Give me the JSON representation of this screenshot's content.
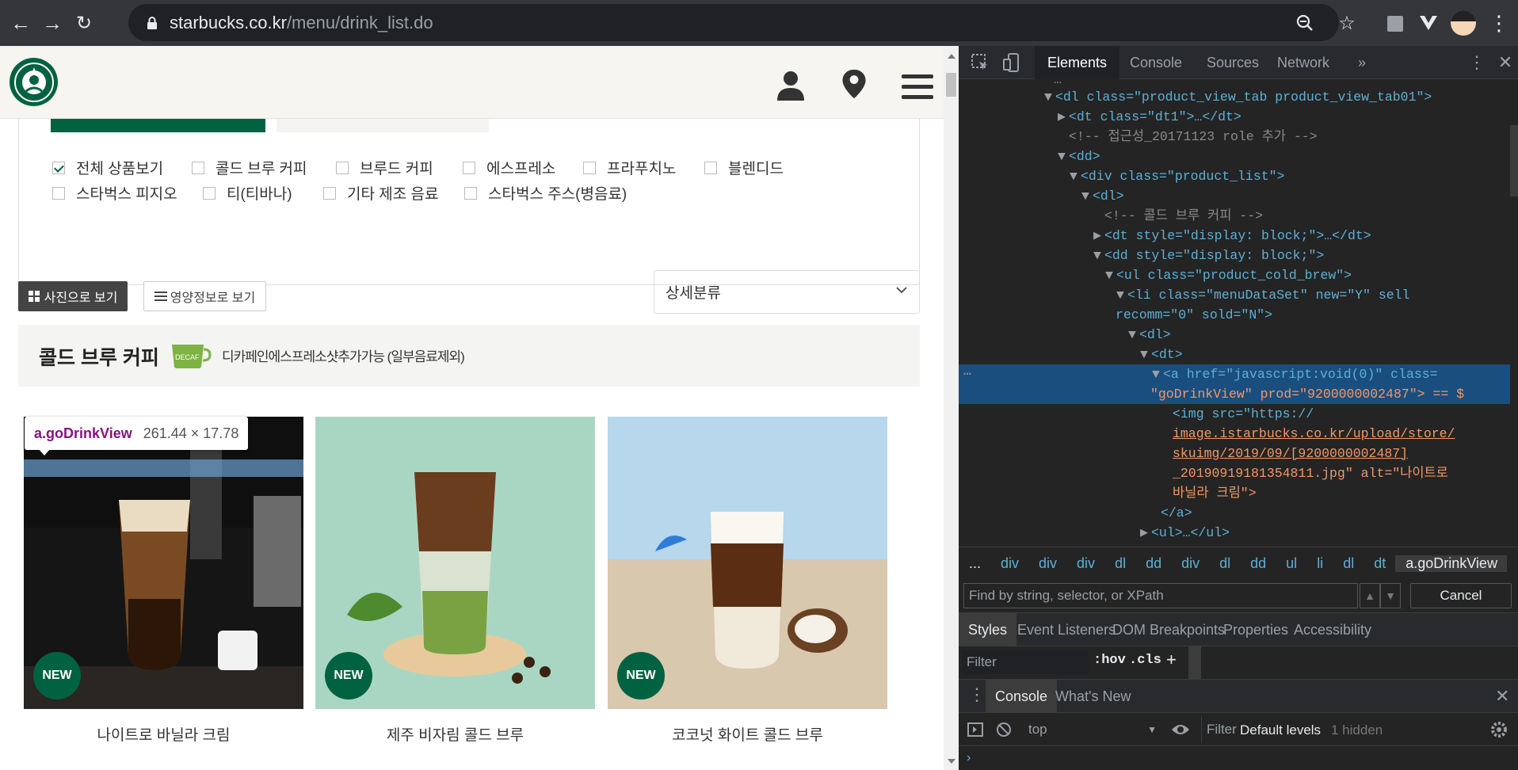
{
  "browser": {
    "url_host": "starbucks.co.kr",
    "url_path": "/menu/drink_list.do"
  },
  "filters": [
    {
      "label": "전체 상품보기",
      "checked": true
    },
    {
      "label": "콜드 브루 커피",
      "checked": false
    },
    {
      "label": "브루드 커피",
      "checked": false
    },
    {
      "label": "에스프레소",
      "checked": false
    },
    {
      "label": "프라푸치노",
      "checked": false
    },
    {
      "label": "블렌디드",
      "checked": false
    },
    {
      "label": "스타벅스 피지오",
      "checked": false
    },
    {
      "label": "티(티바나)",
      "checked": false
    },
    {
      "label": "기타 제조 음료",
      "checked": false
    },
    {
      "label": "스타벅스 주스(병음료)",
      "checked": false
    }
  ],
  "view_buttons": {
    "photo": "사진으로 보기",
    "nutrition": "영양정보로 보기"
  },
  "select": {
    "value": "상세분류"
  },
  "category": {
    "title": "콜드 브루 커피",
    "decaf_badge": "DECAF",
    "decaf_note": "디카페인에스프레소샷추가가능 (일부음료제외)"
  },
  "tooltip": {
    "selector": "a.goDrinkView",
    "size": "261.44 × 17.78"
  },
  "products": [
    {
      "name": "나이트로 바닐라 크림",
      "badge": "NEW"
    },
    {
      "name": "제주 비자림 콜드 브루",
      "badge": "NEW"
    },
    {
      "name": "코코넛 화이트 콜드 브루",
      "badge": "NEW"
    }
  ],
  "devtools": {
    "tabs": [
      "Elements",
      "Console",
      "Sources",
      "Network"
    ],
    "more": "»",
    "tree": [
      {
        "text": "<dl class=\"product_view_tab product_view_tab01\">"
      },
      {
        "text": "<dt class=\"dt1\">…</dt>"
      },
      {
        "text": "<!-- 접근성_20171123 role 추가 -->"
      },
      {
        "text": "<dd>"
      },
      {
        "text": "<div class=\"product_list\">"
      },
      {
        "text": "<dl>"
      },
      {
        "text": "<!-- 콜드 브루 커피 -->"
      },
      {
        "text": "<dt style=\"display: block;\">…</dt>"
      },
      {
        "text": "<dd style=\"display: block;\">"
      },
      {
        "text": "<ul class=\"product_cold_brew\">"
      },
      {
        "text": "<li class=\"menuDataSet\" new=\"Y\" sell"
      },
      {
        "text": "recomm=\"0\" sold=\"N\">"
      },
      {
        "text": "<dl>"
      },
      {
        "text": "<dt>"
      },
      {
        "text": "<a href=\"javascript:void(0)\" class="
      },
      {
        "text": "\"goDrinkView\" prod=\"9200000002487\"> == $"
      },
      {
        "text": "<img src=\"https://"
      },
      {
        "text": "image.istarbucks.co.kr/upload/store/"
      },
      {
        "text": "skuimg/2019/09/[9200000002487]"
      },
      {
        "text": "_20190919181354811.jpg\" alt=\"나이트로"
      },
      {
        "text": "바닐라 크림\">"
      },
      {
        "text": "</a>"
      },
      {
        "text": "<ul>…</ul>"
      }
    ],
    "breadcrumb": [
      "...",
      "div",
      "div",
      "div",
      "dl",
      "dd",
      "div",
      "dl",
      "dd",
      "ul",
      "li",
      "dl",
      "dt",
      "a.goDrinkView"
    ],
    "find_placeholder": "Find by string, selector, or XPath",
    "cancel": "Cancel",
    "panel_tabs": [
      "Styles",
      "Event Listeners",
      "DOM Breakpoints",
      "Properties",
      "Accessibility"
    ],
    "styles_filter": "Filter",
    "hov": ":hov",
    "cls": ".cls",
    "plus": "+",
    "drawer_tabs": [
      "Console",
      "What's New"
    ],
    "console_context": "top",
    "console_filter": "Filter",
    "levels": "Default levels",
    "hidden": "1 hidden"
  }
}
